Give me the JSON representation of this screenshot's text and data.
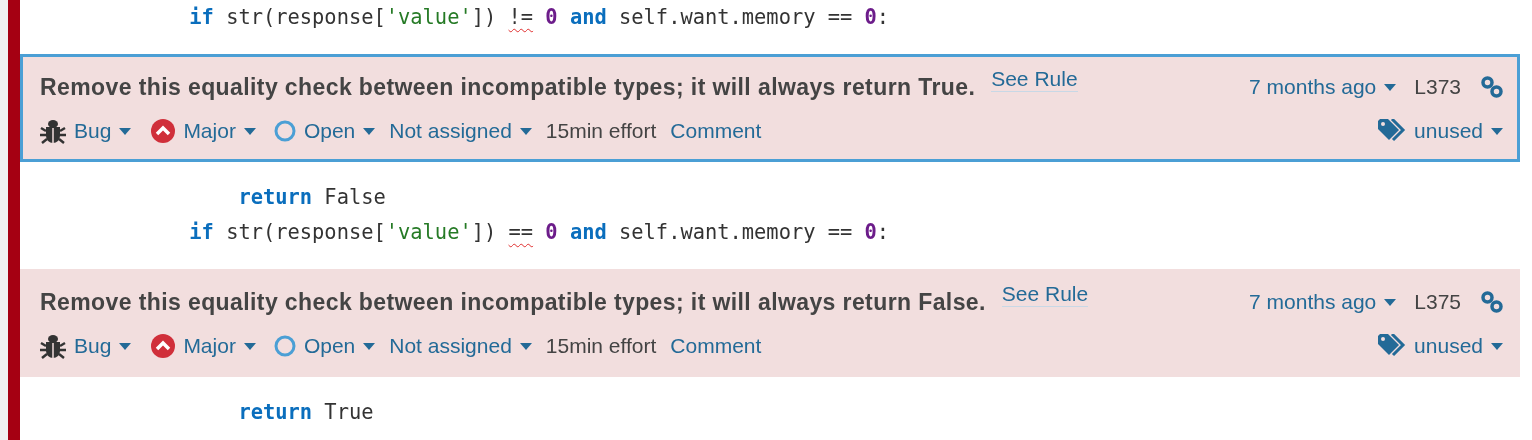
{
  "blocks": [
    {
      "kind": "code",
      "tokens": [
        {
          "text": "            if",
          "kind": "keyword"
        },
        {
          "text": " str(response[",
          "kind": "plain"
        },
        {
          "text": "'value'",
          "kind": "string"
        },
        {
          "text": "]) ",
          "kind": "plain"
        },
        {
          "text": "!=",
          "kind": "flagged"
        },
        {
          "text": " 0",
          "kind": "number"
        },
        {
          "text": " and",
          "kind": "keyword"
        },
        {
          "text": " self.want.memory == ",
          "kind": "plain"
        },
        {
          "text": "0",
          "kind": "number"
        },
        {
          "text": ":",
          "kind": "plain"
        }
      ]
    },
    {
      "kind": "issue",
      "selected": true,
      "message": "Remove this equality check between incompatible types; it will always return True.",
      "rule_link": "See Rule",
      "date": "7 months ago",
      "line": "L373",
      "type": "Bug",
      "severity": "Major",
      "status": "Open",
      "assignee": "Not assigned",
      "effort": "15min effort",
      "comment": "Comment",
      "tag": "unused"
    },
    {
      "kind": "code",
      "tokens": [
        {
          "text": "                return",
          "kind": "keyword"
        },
        {
          "text": " False",
          "kind": "plain"
        }
      ]
    },
    {
      "kind": "code",
      "tokens": [
        {
          "text": "            if",
          "kind": "keyword"
        },
        {
          "text": " str(response[",
          "kind": "plain"
        },
        {
          "text": "'value'",
          "kind": "string"
        },
        {
          "text": "]) ",
          "kind": "plain"
        },
        {
          "text": "==",
          "kind": "flagged"
        },
        {
          "text": " 0",
          "kind": "number"
        },
        {
          "text": " and",
          "kind": "keyword"
        },
        {
          "text": " self.want.memory == ",
          "kind": "plain"
        },
        {
          "text": "0",
          "kind": "number"
        },
        {
          "text": ":",
          "kind": "plain"
        }
      ]
    },
    {
      "kind": "issue",
      "selected": false,
      "message": "Remove this equality check between incompatible types; it will always return False.",
      "rule_link": "See Rule",
      "date": "7 months ago",
      "line": "L375",
      "type": "Bug",
      "severity": "Major",
      "status": "Open",
      "assignee": "Not assigned",
      "effort": "15min effort",
      "comment": "Comment",
      "tag": "unused"
    },
    {
      "kind": "code",
      "tokens": [
        {
          "text": "                return",
          "kind": "keyword"
        },
        {
          "text": " True",
          "kind": "plain"
        }
      ]
    }
  ]
}
